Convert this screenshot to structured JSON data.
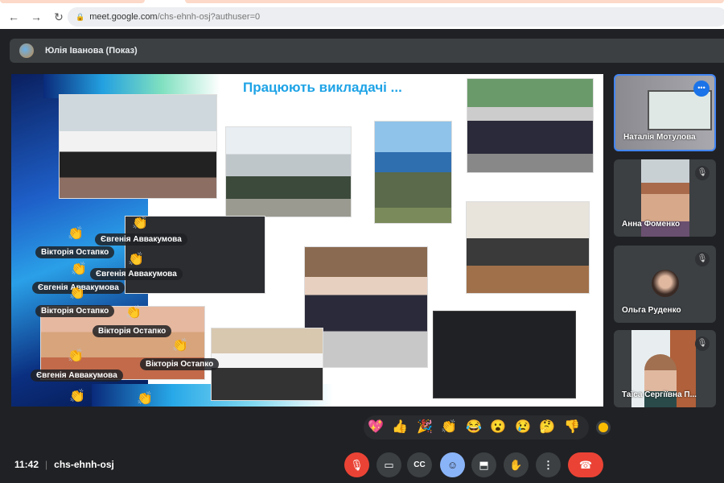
{
  "browser": {
    "url_host": "meet.google.com",
    "url_path": "/chs-ehnh-osj?authuser=0"
  },
  "presenter_bar": {
    "label": "Юлія Іванова (Показ)"
  },
  "slide": {
    "title": "Працюють викладачі ...",
    "reaction_labels": [
      "Євгенія Аввакумова",
      "Вікторія Остапко",
      "Євгенія Аввакумова",
      "Євгенія Аввакумова",
      "Вікторія Остапко",
      "Вікторія Остапко",
      "Вікторія Остапко",
      "Євгенія Аввакумова"
    ]
  },
  "participants": [
    {
      "name": "Наталія Мотулова",
      "active": true
    },
    {
      "name": "Анна Фоменко",
      "muted": true
    },
    {
      "name": "Ольга Руденко",
      "muted": true
    },
    {
      "name": "Таїса Сергіївна П...",
      "muted": true
    }
  ],
  "reactions": [
    "💖",
    "👍",
    "🎉",
    "👏",
    "😂",
    "😮",
    "😢",
    "🤔",
    "👎"
  ],
  "meeting": {
    "time": "11:42",
    "code": "chs-ehnh-osj"
  },
  "colors": {
    "accent": "#8ab4f8",
    "danger": "#ea4335",
    "title": "#1ea3e6"
  }
}
